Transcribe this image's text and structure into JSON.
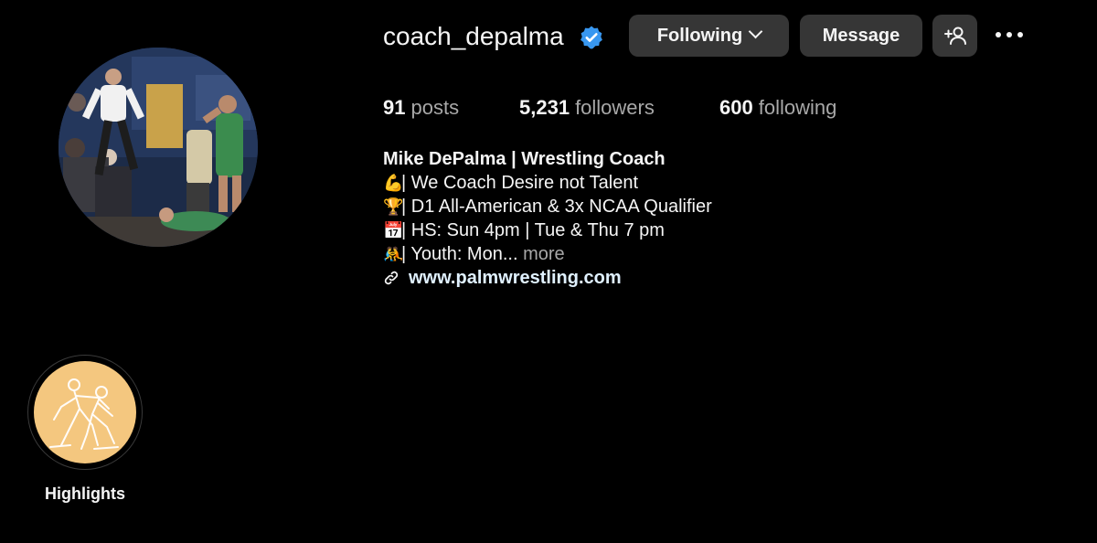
{
  "profile": {
    "username": "coach_depalma",
    "verified": true,
    "accent_color": "#3897f0"
  },
  "actions": {
    "following_label": "Following",
    "message_label": "Message",
    "add_user_icon": "add-person-icon",
    "more_icon": "more-options-icon"
  },
  "stats": {
    "posts_count": "91",
    "posts_label": "posts",
    "followers_count": "5,231",
    "followers_label": "followers",
    "following_count": "600",
    "following_label": "following"
  },
  "bio": {
    "name": "Mike DePalma | Wrestling Coach",
    "lines": [
      {
        "emoji": "💪",
        "text": "| We Coach Desire not Talent"
      },
      {
        "emoji": "🏆",
        "text": "| D1 All-American & 3x NCAA Qualifier"
      },
      {
        "emoji": "📅",
        "text": "| HS: Sun 4pm | Tue & Thu 7 pm"
      },
      {
        "emoji": "🤼",
        "text": "| Youth: Mon..."
      }
    ],
    "more_label": "more",
    "website": "www.palmwrestling.com"
  },
  "highlights": [
    {
      "label": "Highlights",
      "cover_color": "#f4c77f",
      "cover_icon": "wrestlers-icon"
    }
  ]
}
